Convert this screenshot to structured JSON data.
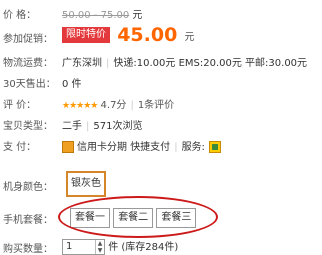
{
  "price": {
    "label": "价      格：",
    "original": "50.00 - 75.00",
    "unit": "元"
  },
  "promo": {
    "label": "参加促销：",
    "badge": "限时特价",
    "price": "45.00",
    "unit": "元"
  },
  "shipping": {
    "label": "物流运费：",
    "location": "广东深圳",
    "express": "快递:10.00元",
    "ems": "EMS:20.00元",
    "mail": "平邮:30.00元"
  },
  "sold": {
    "label": "30天售出：",
    "value": "0 件"
  },
  "rating": {
    "label": "评      价：",
    "stars": "★★★★★",
    "score": "4.7分",
    "reviews": "1条评价"
  },
  "status": {
    "label": "宝贝类型：",
    "condition": "二手",
    "views": "571次浏览"
  },
  "payment": {
    "label": "支      付：",
    "method": "信用卡分期",
    "quick": "快捷支付",
    "service_label": "服务:"
  },
  "color": {
    "label": "机身颜色：",
    "option": "银灰色"
  },
  "package": {
    "label": "手机套餐：",
    "options": [
      "套餐一",
      "套餐二",
      "套餐三"
    ]
  },
  "quantity": {
    "label": "购买数量：",
    "value": "1",
    "unit": "件",
    "stock": "(库存284件)"
  },
  "colors": {
    "promo_red": "#e4393c",
    "price_orange": "#ff6600",
    "highlight": "#cc1a1a"
  }
}
